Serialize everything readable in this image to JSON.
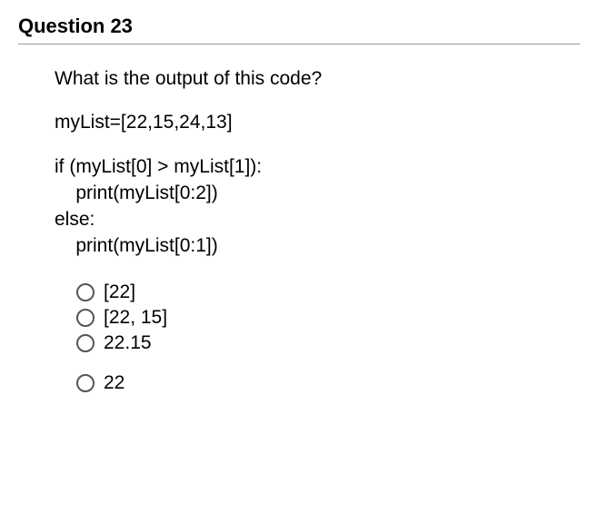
{
  "header": "Question 23",
  "prompt": "What is the output of this code?",
  "code": {
    "l1": "myList=[22,15,24,13]",
    "l2": "if (myList[0] > myList[1]):",
    "l3": "    print(myList[0:2])",
    "l4": "else:",
    "l5": "    print(myList[0:1])"
  },
  "options": {
    "a": "[22]",
    "b": "[22, 15]",
    "c": "22.15",
    "d": "22"
  }
}
